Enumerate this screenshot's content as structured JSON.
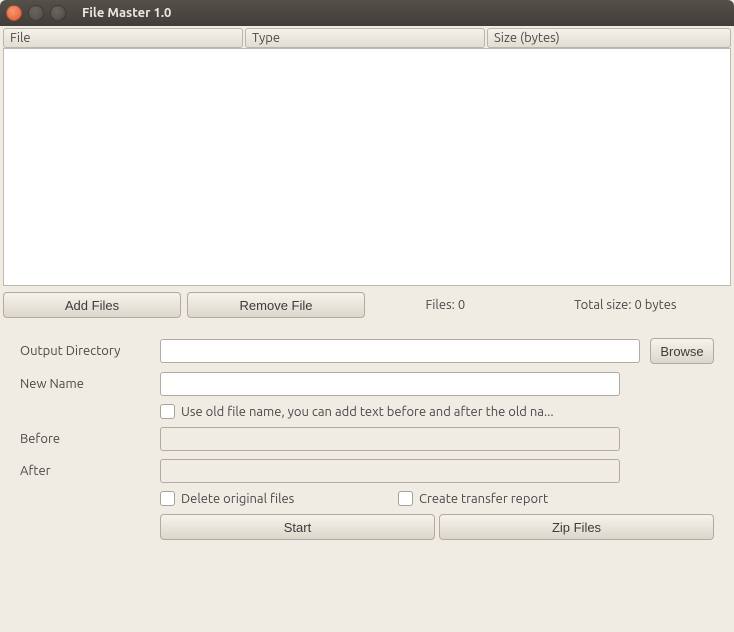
{
  "window": {
    "title": "File Master 1.0"
  },
  "columns": {
    "file": "File",
    "type": "Type",
    "size": "Size (bytes)"
  },
  "buttons": {
    "add_files": "Add Files",
    "remove_file": "Remove File",
    "browse": "Browse",
    "start": "Start",
    "zip_files": "Zip Files"
  },
  "status": {
    "files_label": "Files:",
    "files_count": "0",
    "total_label": "Total size:",
    "total_value": "0 bytes"
  },
  "form": {
    "output_dir_label": "Output Directory",
    "new_name_label": "New Name",
    "use_old_label": "Use old file name, you can add text before and after the old na...",
    "before_label": "Before",
    "after_label": "After",
    "delete_label": "Delete original files",
    "report_label": "Create transfer report",
    "output_dir_value": "",
    "new_name_value": "",
    "before_value": "",
    "after_value": ""
  }
}
